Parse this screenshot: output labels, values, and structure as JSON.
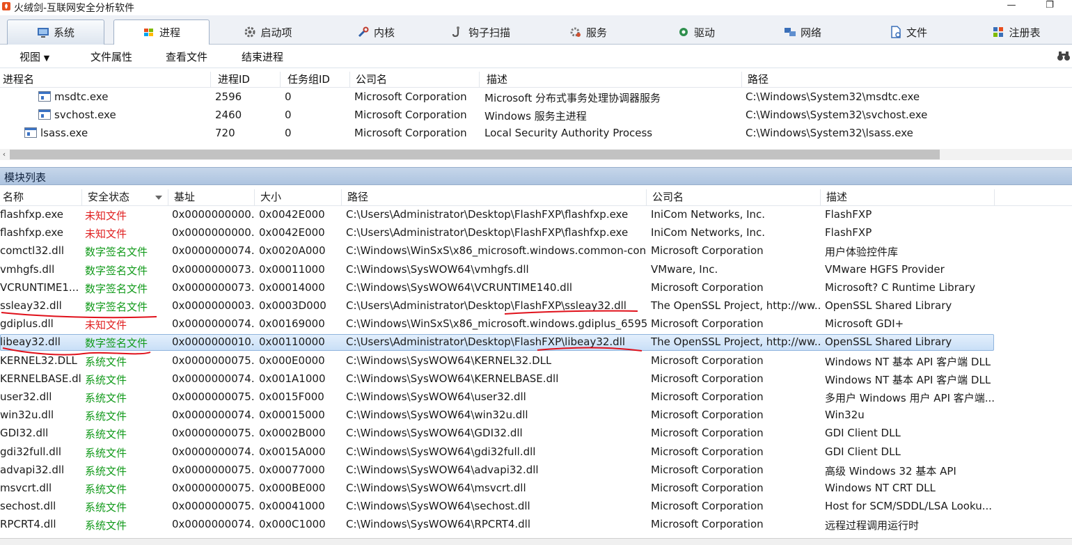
{
  "window": {
    "title": "火绒剑-互联网安全分析软件",
    "minimize": "—",
    "maximize": "❐"
  },
  "tabs": [
    {
      "label": "系统",
      "icon": "system-monitor-icon"
    },
    {
      "label": "进程",
      "icon": "windows-flag-icon"
    },
    {
      "label": "启动项",
      "icon": "gear-icon"
    },
    {
      "label": "内核",
      "icon": "tools-icon"
    },
    {
      "label": "钩子扫描",
      "icon": "hook-icon"
    },
    {
      "label": "服务",
      "icon": "service-gear-icon"
    },
    {
      "label": "驱动",
      "icon": "driver-icon"
    },
    {
      "label": "网络",
      "icon": "network-icon"
    },
    {
      "label": "文件",
      "icon": "file-icon"
    },
    {
      "label": "注册表",
      "icon": "registry-icon"
    }
  ],
  "toolbar": {
    "view": "视图",
    "file_props": "文件属性",
    "view_file": "查看文件",
    "end_process": "结束进程"
  },
  "process_table": {
    "headers": [
      "进程名",
      "进程ID",
      "任务组ID",
      "公司名",
      "描述",
      "路径"
    ],
    "rows": [
      {
        "name": "msdtc.exe",
        "pid": "2596",
        "gid": "0",
        "company": "Microsoft Corporation",
        "desc": "Microsoft 分布式事务处理协调器服务",
        "path": "C:\\Windows\\System32\\msdtc.exe"
      },
      {
        "name": "svchost.exe",
        "pid": "2460",
        "gid": "0",
        "company": "Microsoft Corporation",
        "desc": "Windows 服务主进程",
        "path": "C:\\Windows\\System32\\svchost.exe"
      },
      {
        "name": "lsass.exe",
        "pid": "720",
        "gid": "0",
        "company": "Microsoft Corporation",
        "desc": "Local Security Authority Process",
        "path": "C:\\Windows\\System32\\lsass.exe"
      }
    ]
  },
  "module_list": {
    "title": "模块列表",
    "headers": [
      "名称",
      "安全状态",
      "基址",
      "大小",
      "路径",
      "公司名",
      "描述"
    ],
    "rows": [
      {
        "name": "flashfxp.exe",
        "status": "未知文件",
        "status_type": "unknown",
        "base": "0x0000000000...",
        "size": "0x0042E000",
        "path": "C:\\Users\\Administrator\\Desktop\\FlashFXP\\flashfxp.exe",
        "company": "IniCom Networks, Inc.",
        "desc": "FlashFXP"
      },
      {
        "name": "flashfxp.exe",
        "status": "未知文件",
        "status_type": "unknown",
        "base": "0x0000000000...",
        "size": "0x0042E000",
        "path": "C:\\Users\\Administrator\\Desktop\\FlashFXP\\flashfxp.exe",
        "company": "IniCom Networks, Inc.",
        "desc": "FlashFXP"
      },
      {
        "name": "comctl32.dll",
        "status": "数字签名文件",
        "status_type": "signed",
        "base": "0x0000000074...",
        "size": "0x0020A000",
        "path": "C:\\Windows\\WinSxS\\x86_microsoft.windows.common-con...",
        "company": "Microsoft Corporation",
        "desc": "用户体验控件库"
      },
      {
        "name": "vmhgfs.dll",
        "status": "数字签名文件",
        "status_type": "signed",
        "base": "0x0000000073...",
        "size": "0x00011000",
        "path": "C:\\Windows\\SysWOW64\\vmhgfs.dll",
        "company": "VMware, Inc.",
        "desc": "VMware HGFS Provider"
      },
      {
        "name": "VCRUNTIME1...",
        "status": "数字签名文件",
        "status_type": "signed",
        "base": "0x0000000073...",
        "size": "0x00014000",
        "path": "C:\\Windows\\SysWOW64\\VCRUNTIME140.dll",
        "company": "Microsoft Corporation",
        "desc": "Microsoft? C Runtime Library"
      },
      {
        "name": "ssleay32.dll",
        "status": "数字签名文件",
        "status_type": "signed",
        "base": "0x0000000003...",
        "size": "0x0003D000",
        "path": "C:\\Users\\Administrator\\Desktop\\FlashFXP\\ssleay32.dll",
        "company": "The OpenSSL Project, http://ww...",
        "desc": "OpenSSL Shared Library"
      },
      {
        "name": "gdiplus.dll",
        "status": "未知文件",
        "status_type": "unknown",
        "base": "0x0000000074...",
        "size": "0x00169000",
        "path": "C:\\Windows\\WinSxS\\x86_microsoft.windows.gdiplus_6595...",
        "company": "Microsoft Corporation",
        "desc": "Microsoft GDI+"
      },
      {
        "name": "libeay32.dll",
        "status": "数字签名文件",
        "status_type": "signed",
        "base": "0x0000000010...",
        "size": "0x00110000",
        "path": "C:\\Users\\Administrator\\Desktop\\FlashFXP\\libeay32.dll",
        "company": "The OpenSSL Project, http://ww...",
        "desc": "OpenSSL Shared Library",
        "selected": true
      },
      {
        "name": "KERNEL32.DLL",
        "status": "系统文件",
        "status_type": "system",
        "base": "0x0000000075...",
        "size": "0x000E0000",
        "path": "C:\\Windows\\SysWOW64\\KERNEL32.DLL",
        "company": "Microsoft Corporation",
        "desc": "Windows NT 基本 API 客户端 DLL"
      },
      {
        "name": "KERNELBASE.dll",
        "status": "系统文件",
        "status_type": "system",
        "base": "0x0000000074...",
        "size": "0x001A1000",
        "path": "C:\\Windows\\SysWOW64\\KERNELBASE.dll",
        "company": "Microsoft Corporation",
        "desc": "Windows NT 基本 API 客户端 DLL"
      },
      {
        "name": "user32.dll",
        "status": "系统文件",
        "status_type": "system",
        "base": "0x0000000075...",
        "size": "0x0015F000",
        "path": "C:\\Windows\\SysWOW64\\user32.dll",
        "company": "Microsoft Corporation",
        "desc": "多用户 Windows 用户 API 客户端..."
      },
      {
        "name": "win32u.dll",
        "status": "系统文件",
        "status_type": "system",
        "base": "0x0000000074...",
        "size": "0x00015000",
        "path": "C:\\Windows\\SysWOW64\\win32u.dll",
        "company": "Microsoft Corporation",
        "desc": "Win32u"
      },
      {
        "name": "GDI32.dll",
        "status": "系统文件",
        "status_type": "system",
        "base": "0x0000000075...",
        "size": "0x0002B000",
        "path": "C:\\Windows\\SysWOW64\\GDI32.dll",
        "company": "Microsoft Corporation",
        "desc": "GDI Client DLL"
      },
      {
        "name": "gdi32full.dll",
        "status": "系统文件",
        "status_type": "system",
        "base": "0x0000000074...",
        "size": "0x0015A000",
        "path": "C:\\Windows\\SysWOW64\\gdi32full.dll",
        "company": "Microsoft Corporation",
        "desc": "GDI Client DLL"
      },
      {
        "name": "advapi32.dll",
        "status": "系统文件",
        "status_type": "system",
        "base": "0x0000000075...",
        "size": "0x00077000",
        "path": "C:\\Windows\\SysWOW64\\advapi32.dll",
        "company": "Microsoft Corporation",
        "desc": "高级 Windows 32 基本 API"
      },
      {
        "name": "msvcrt.dll",
        "status": "系统文件",
        "status_type": "system",
        "base": "0x0000000075...",
        "size": "0x000BE000",
        "path": "C:\\Windows\\SysWOW64\\msvcrt.dll",
        "company": "Microsoft Corporation",
        "desc": "Windows NT CRT DLL"
      },
      {
        "name": "sechost.dll",
        "status": "系统文件",
        "status_type": "system",
        "base": "0x0000000075...",
        "size": "0x00041000",
        "path": "C:\\Windows\\SysWOW64\\sechost.dll",
        "company": "Microsoft Corporation",
        "desc": "Host for SCM/SDDL/LSA Looku..."
      },
      {
        "name": "RPCRT4.dll",
        "status": "系统文件",
        "status_type": "system",
        "base": "0x0000000074...",
        "size": "0x000C1000",
        "path": "C:\\Windows\\SysWOW64\\RPCRT4.dll",
        "company": "Microsoft Corporation",
        "desc": "远程过程调用运行时"
      }
    ]
  },
  "colors": {
    "unknown": "#e02020",
    "signed": "#119a1a",
    "system": "#119a1a",
    "annotation": "#e0101a",
    "selection": "#c9dff7"
  }
}
